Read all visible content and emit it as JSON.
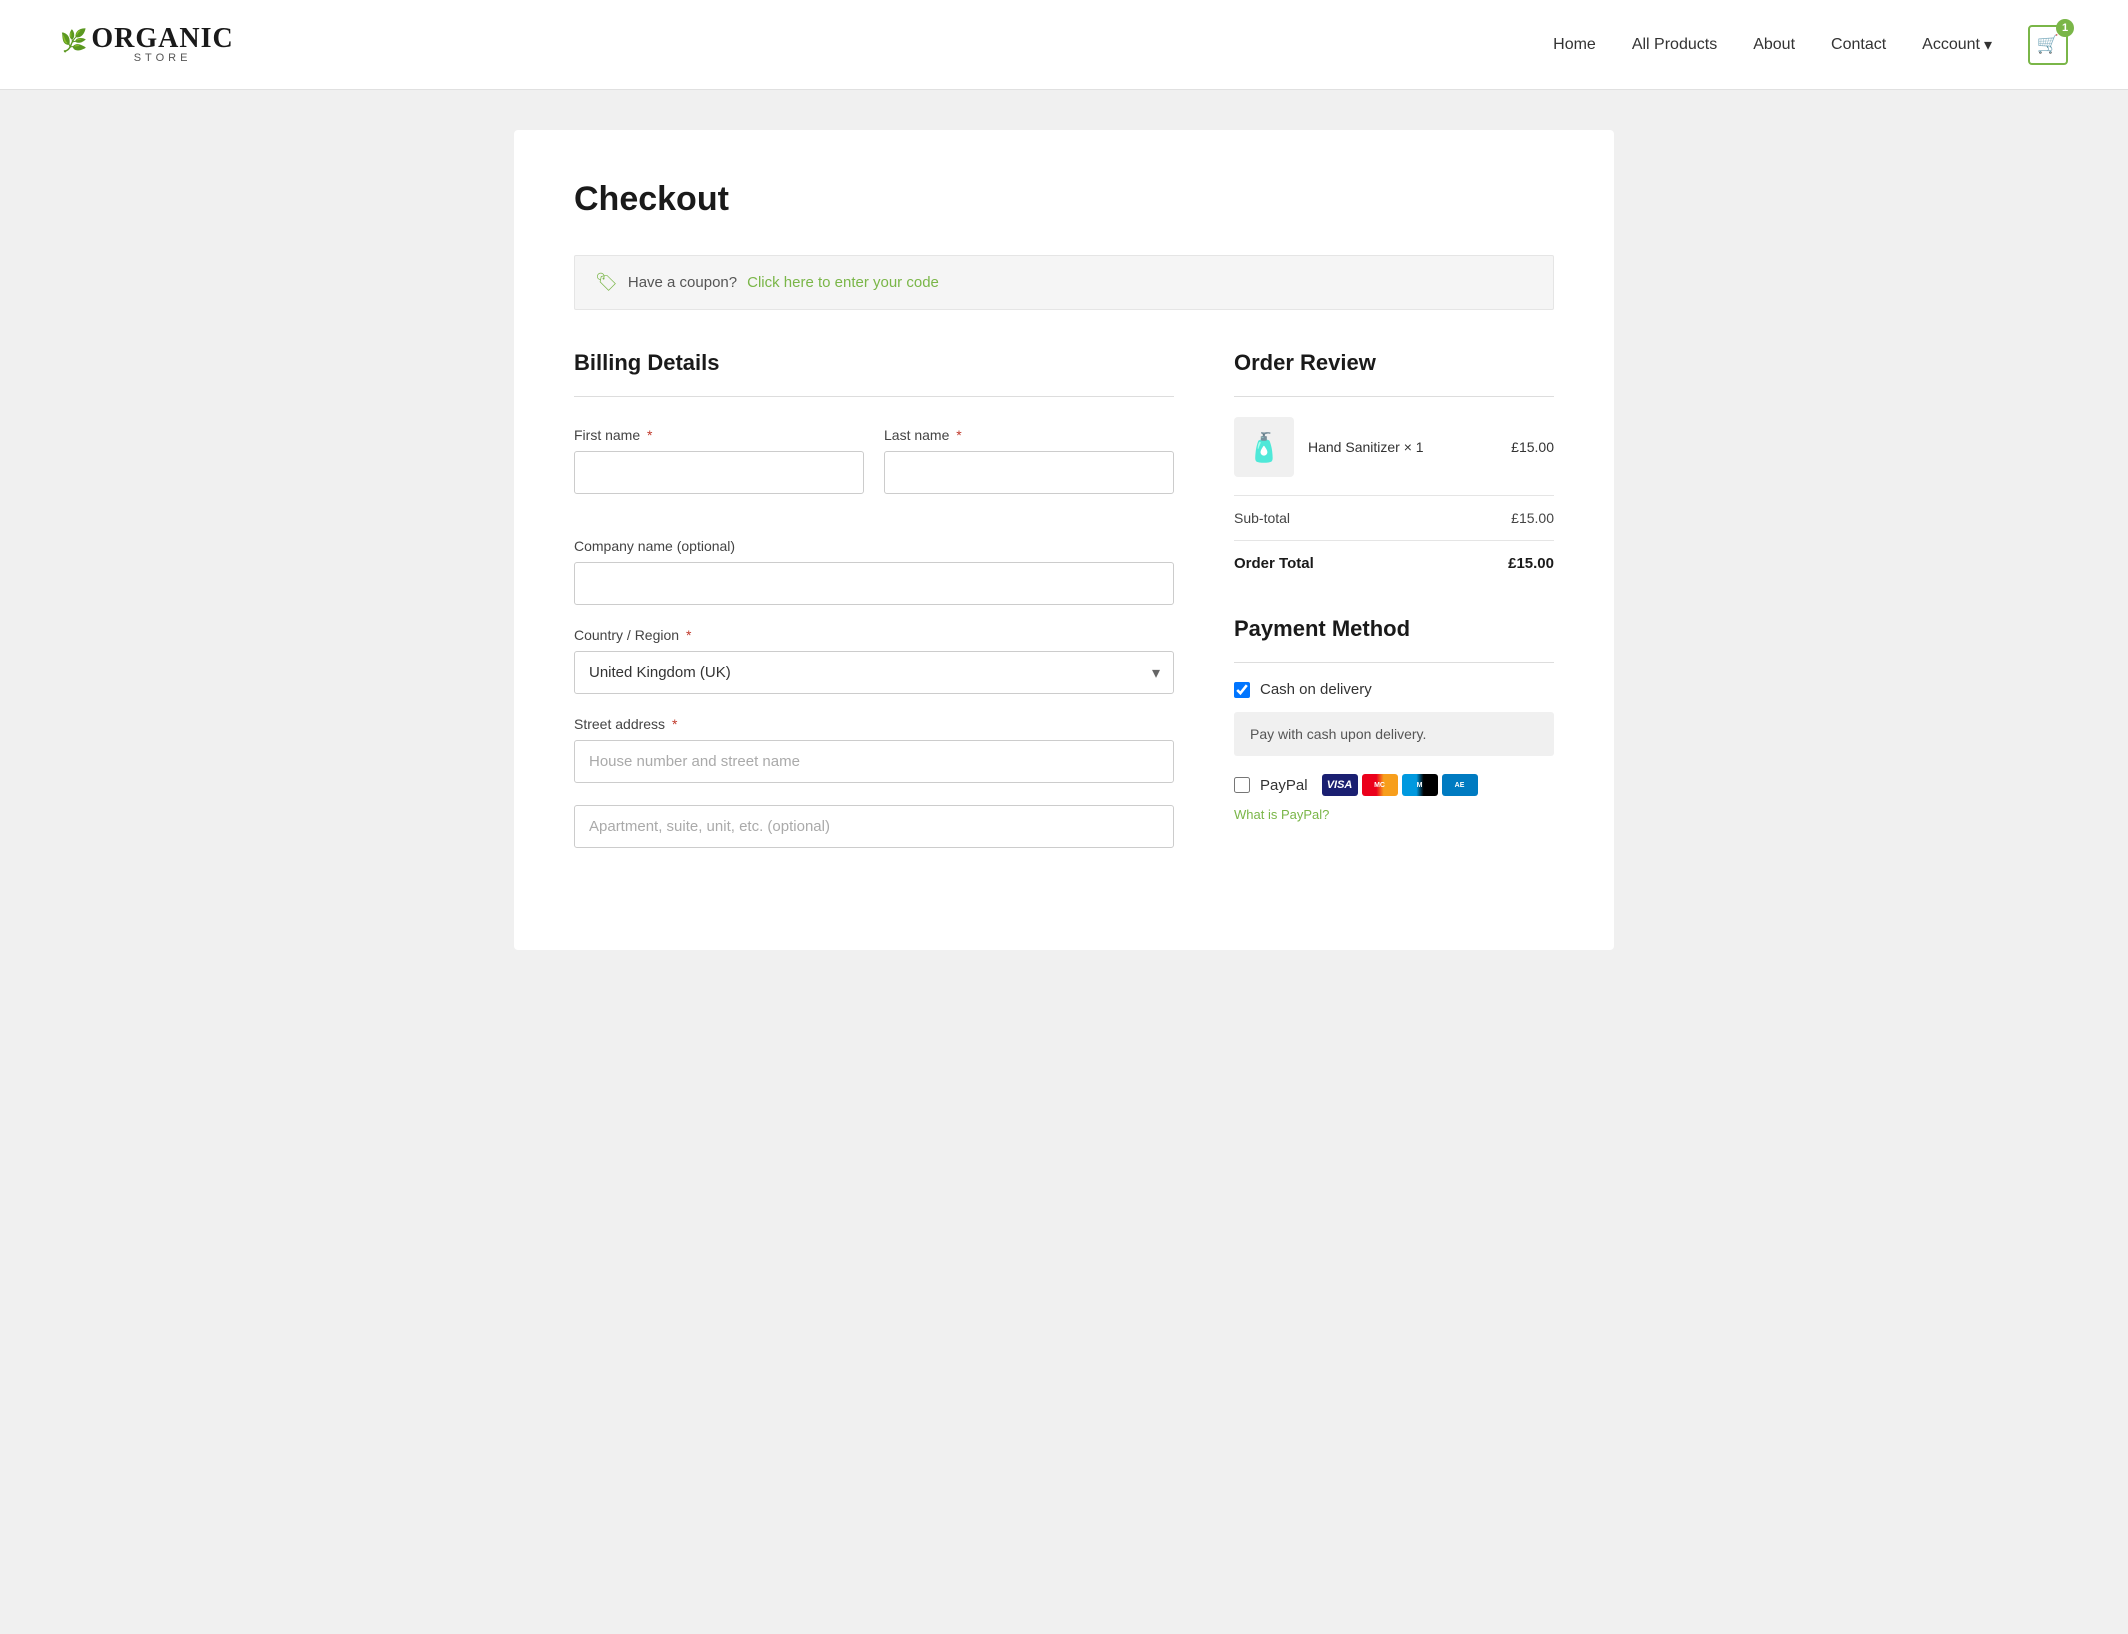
{
  "site": {
    "logo_name": "ORGANIC",
    "logo_sub": "STORE"
  },
  "nav": {
    "items": [
      {
        "id": "home",
        "label": "Home"
      },
      {
        "id": "all-products",
        "label": "All Products"
      },
      {
        "id": "about",
        "label": "About"
      },
      {
        "id": "contact",
        "label": "Contact"
      },
      {
        "id": "account",
        "label": "Account"
      }
    ],
    "cart_count": "1"
  },
  "page": {
    "title": "Checkout"
  },
  "coupon": {
    "text": "Have a coupon?",
    "link_text": "Click here to enter your code"
  },
  "billing": {
    "title": "Billing Details",
    "fields": {
      "first_name_label": "First name",
      "last_name_label": "Last name",
      "company_label": "Company name (optional)",
      "country_label": "Country / Region",
      "country_value": "United Kingdom (UK)",
      "street_label": "Street address",
      "street_placeholder": "House number and street name",
      "apt_placeholder": "Apartment, suite, unit, etc. (optional)"
    }
  },
  "order_review": {
    "title": "Order Review",
    "item": {
      "name": "Hand Sanitizer",
      "quantity": "× 1",
      "price": "£15.00",
      "emoji": "🧴"
    },
    "subtotal_label": "Sub-total",
    "subtotal_value": "£15.00",
    "total_label": "Order Total",
    "total_value": "£15.00"
  },
  "payment": {
    "title": "Payment Method",
    "methods": [
      {
        "id": "cash",
        "label": "Cash on delivery",
        "checked": true,
        "description": "Pay with cash upon delivery."
      },
      {
        "id": "paypal",
        "label": "PayPal",
        "checked": false
      }
    ],
    "paypal_what_text": "What is PayPal?"
  }
}
